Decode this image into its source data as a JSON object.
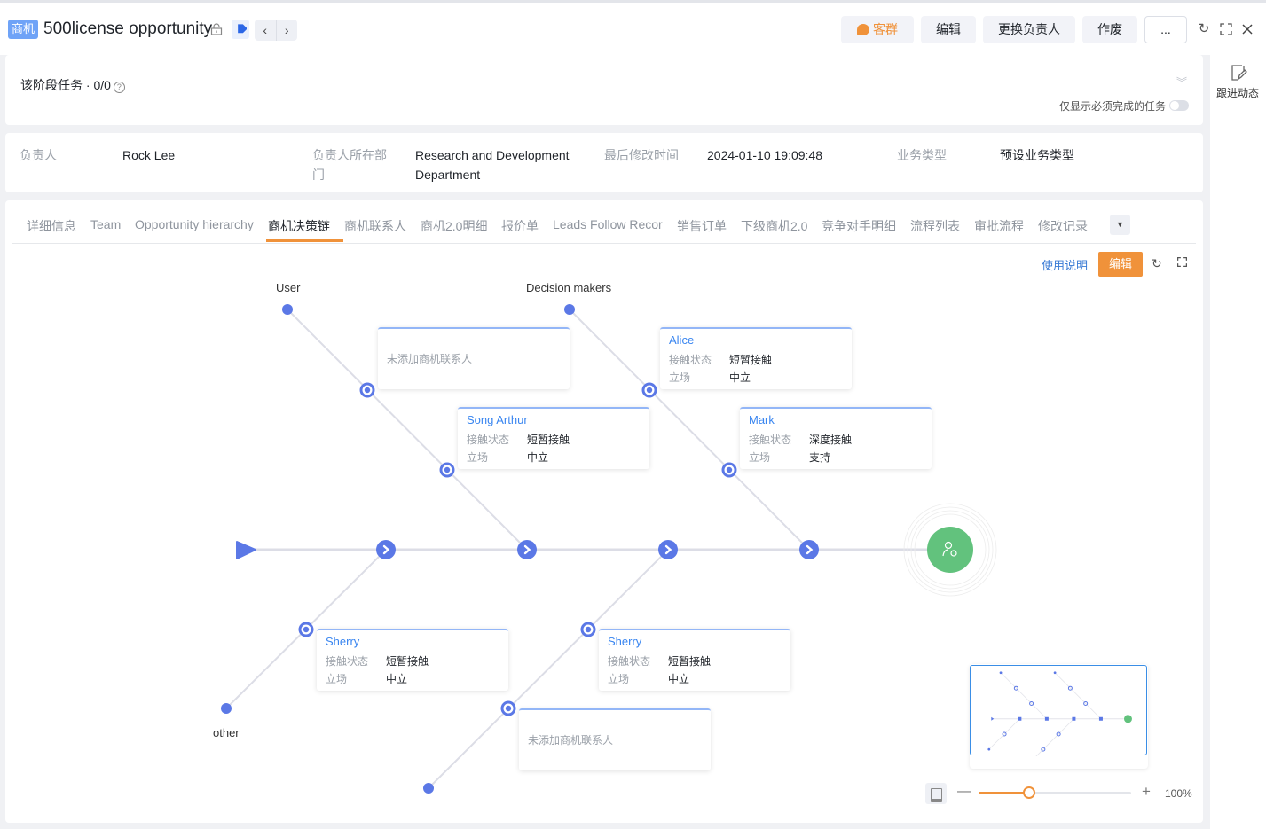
{
  "header": {
    "object_badge": "商机",
    "title": "500license opportunity",
    "buttons": {
      "customer_group": "客群",
      "edit": "编辑",
      "change_owner": "更换负责人",
      "void": "作废",
      "more": "..."
    },
    "icons": [
      "lock-icon",
      "tag-icon",
      "chevron-left-icon",
      "chevron-right-icon",
      "refresh-icon",
      "fullscreen-icon",
      "close-icon"
    ]
  },
  "right_rail": {
    "follow_label": "跟进动态"
  },
  "stage": {
    "task_label": "该阶段任务 · 0/0",
    "only_required_label": "仅显示必须完成的任务",
    "only_required_on": false
  },
  "info": {
    "fields": [
      {
        "label": "负责人",
        "value": "Rock Lee"
      },
      {
        "label": "负责人所在部门",
        "value": "Research and Development Department"
      },
      {
        "label": "最后修改时间",
        "value": "2024-01-10 19:09:48"
      },
      {
        "label": "业务类型",
        "value": "预设业务类型"
      }
    ]
  },
  "tabs": {
    "items": [
      "详细信息",
      "Team",
      "Opportunity hierarchy",
      "商机决策链",
      "商机联系人",
      "商机2.0明细",
      "报价单",
      "Leads Follow Recor",
      "销售订单",
      "下级商机2.0",
      "竞争对手明细",
      "流程列表",
      "审批流程",
      "修改记录"
    ],
    "active_index": 3
  },
  "toolbar": {
    "usage_link": "使用说明",
    "edit_label": "编辑"
  },
  "diagram": {
    "branches": [
      {
        "label": "User",
        "position": "top"
      },
      {
        "label": "Decision makers",
        "position": "top"
      },
      {
        "label": "other",
        "position": "bottom"
      },
      {
        "label": "",
        "position": "bottom"
      }
    ],
    "empty_text": "未添加商机联系人",
    "field_labels": {
      "contact_status": "接触状态",
      "stance": "立场"
    },
    "cards": [
      {
        "branch": "User",
        "empty": true
      },
      {
        "branch": "User",
        "name": "Song Arthur",
        "contact_status": "短暂接触",
        "stance": "中立"
      },
      {
        "branch": "Decision makers",
        "name": "Alice",
        "contact_status": "短暂接触",
        "stance": "中立"
      },
      {
        "branch": "Decision makers",
        "name": "Mark",
        "contact_status": "深度接触",
        "stance": "支持"
      },
      {
        "branch": "other",
        "name": "Sherry",
        "contact_status": "短暂接触",
        "stance": "中立"
      },
      {
        "branch": "",
        "name": "Sherry",
        "contact_status": "短暂接触",
        "stance": "中立"
      },
      {
        "branch": "",
        "empty": true
      }
    ],
    "colors": {
      "node": "#5b78e6",
      "line": "#dcdde6",
      "goal": "#62c27d",
      "card_top": "#93b6f7"
    }
  },
  "zoom_control": {
    "percent_label": "100%",
    "level_fraction": 0.33
  }
}
